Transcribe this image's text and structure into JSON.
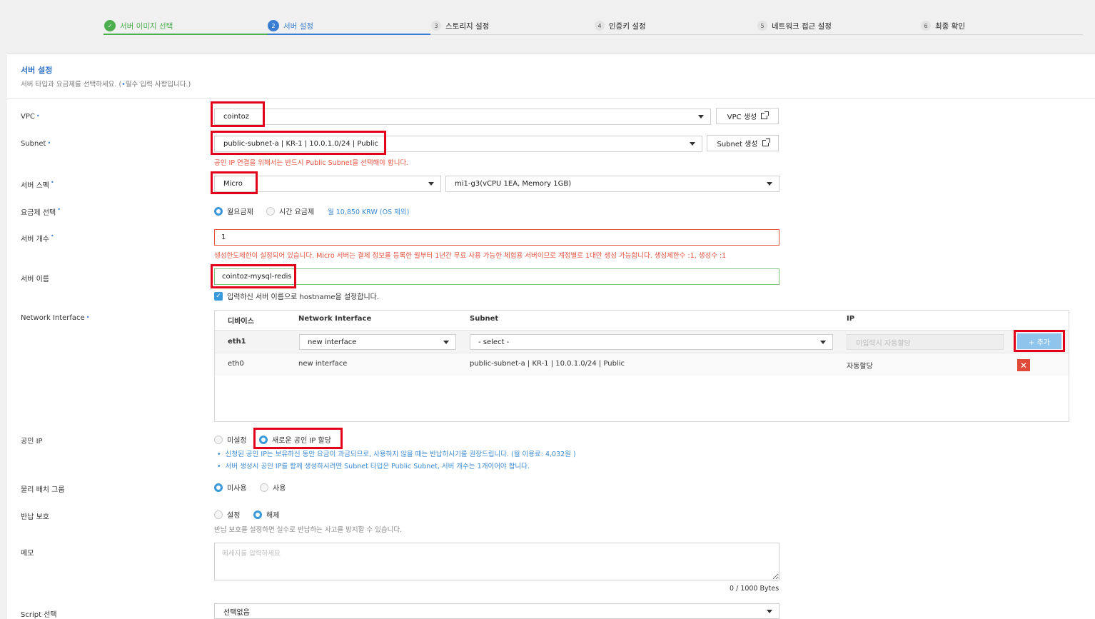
{
  "steps": [
    {
      "num": "✓",
      "label": "서버 이미지 선택"
    },
    {
      "num": "2",
      "label": "서버 설정"
    },
    {
      "num": "3",
      "label": "스토리지 설정"
    },
    {
      "num": "4",
      "label": "인증키 설정"
    },
    {
      "num": "5",
      "label": "네트워크 접근 설정"
    },
    {
      "num": "6",
      "label": "최종 확인"
    }
  ],
  "section": {
    "title": "서버 설정",
    "subtitle": "서버 타입과 요금제를 선택하세요. (",
    "subtitle_req": "•",
    "subtitle_end": "필수 입력 사항입니다.)"
  },
  "req_mark": "•",
  "vpc": {
    "label": "VPC",
    "value": "cointoz",
    "button": "VPC 생성"
  },
  "subnet": {
    "label": "Subnet",
    "value": "public-subnet-a | KR-1 | 10.0.1.0/24 | Public",
    "button": "Subnet 생성",
    "warning": "공인 IP 연결을 위해서는 반드시 Public Subnet을 선택해야 합니다."
  },
  "spec": {
    "label": "서버 스펙",
    "type": "Micro",
    "detail": "mi1-g3(vCPU 1EA, Memory 1GB)"
  },
  "plan": {
    "label": "요금제 선택",
    "monthly": "월요금제",
    "hourly": "시간 요금제",
    "price": "월 10,850 KRW (OS 제외)"
  },
  "count": {
    "label": "서버 개수",
    "value": "1",
    "error": "생성한도제한이 설정되어 있습니다. Micro 서버는 결제 정보를 등록한 월부터 1년간 무료 사용 가능한 체험용 서버이므로 계정별로 1대만 생성 가능합니다. 생성제한수 :1, 생성수 :1"
  },
  "name": {
    "label": "서버 이름",
    "value": "cointoz-mysql-redis",
    "hostname_check": "입력하신 서버 이름으로 hostname을 설정합니다."
  },
  "nic": {
    "label": "Network Interface",
    "headers": [
      "디바이스",
      "Network Interface",
      "Subnet",
      "IP"
    ],
    "new_row": {
      "device": "eth1",
      "interface": "new interface",
      "subnet": "- select -",
      "ip_placeholder": "미입력시 자동할당",
      "add_button": "+ 추가"
    },
    "rows": [
      {
        "device": "eth0",
        "interface": "new interface",
        "subnet": "public-subnet-a | KR-1 | 10.0.1.0/24 | Public",
        "ip": "자동할당"
      }
    ]
  },
  "public_ip": {
    "label": "공인 IP",
    "unset": "미설정",
    "new": "새로운 공인 IP 할당",
    "note1": "신청된 공인 IP는 보유하신 동안 요금이 과금되므로, 사용하지 않을 때는 반납하시기를 권장드립니다. (월 이용료: 4,032원 )",
    "note2": "서버 생성시 공인 IP를 함께 생성하시려면 Subnet 타입은 Public Subnet, 서버 개수는 1개이어야 합니다."
  },
  "placement": {
    "label": "물리 배치 그룹",
    "off": "미사용",
    "on": "사용"
  },
  "protect": {
    "label": "반납 보호",
    "set": "설정",
    "unset": "해제",
    "note": "반납 보호를 설정하면 실수로 반납하는 사고를 방지할 수 있습니다."
  },
  "memo": {
    "label": "메모",
    "placeholder": "메세지를 입력하세요",
    "counter": "0 / 1000 Bytes"
  },
  "script": {
    "label": "Script 선택",
    "value": "선택없음"
  },
  "colors": {
    "accent": "#3a7ed4",
    "done": "#4cae4c",
    "highlight": "#e3001b",
    "error": "#e8533f"
  }
}
